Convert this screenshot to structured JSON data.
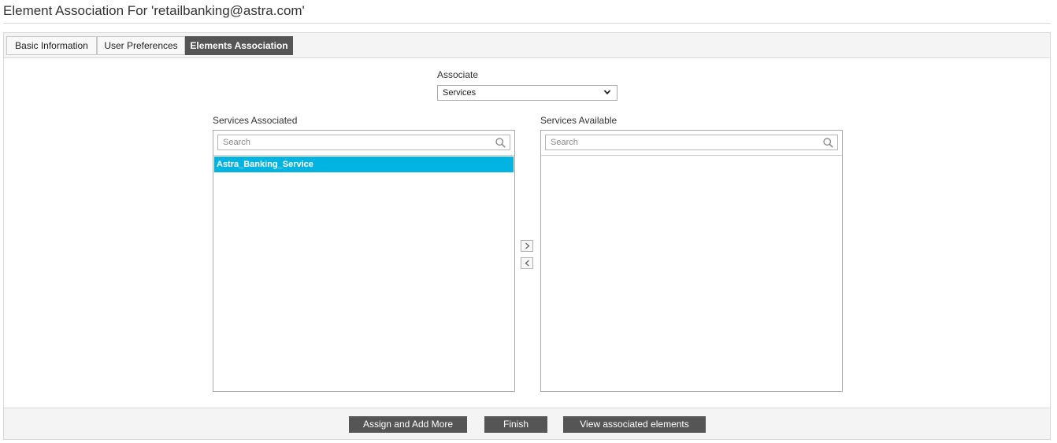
{
  "page": {
    "title": "Element Association For 'retailbanking@astra.com'"
  },
  "tabs": [
    {
      "label": "Basic Information",
      "active": false
    },
    {
      "label": "User Preferences",
      "active": false
    },
    {
      "label": "Elements Association",
      "active": true
    }
  ],
  "associate": {
    "label": "Associate",
    "selected": "Services"
  },
  "associated_list": {
    "label": "Services Associated",
    "search_placeholder": "Search",
    "items": [
      "Astra_Banking_Service"
    ]
  },
  "available_list": {
    "label": "Services Available",
    "search_placeholder": "Search",
    "items": []
  },
  "footer": {
    "assign_label": "Assign and Add More",
    "finish_label": "Finish",
    "view_label": "View associated elements"
  },
  "colors": {
    "tab_active_bg": "#555555",
    "selection_bg": "#00b3e0",
    "button_bg": "#555555"
  },
  "icons": {
    "select_arrow": "chevron-down-icon",
    "search": "search-icon",
    "move_right": "chevron-right-icon",
    "move_left": "chevron-left-icon"
  }
}
